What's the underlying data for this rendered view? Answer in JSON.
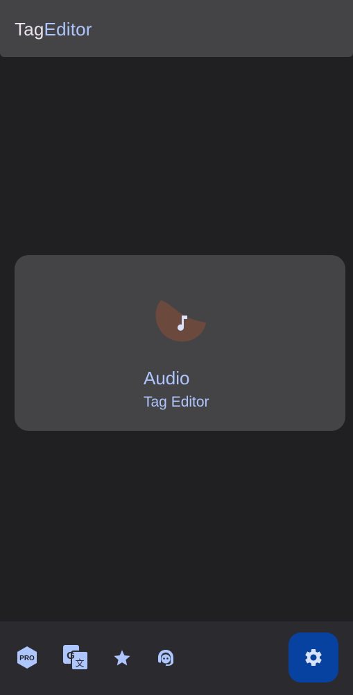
{
  "app_bar": {
    "title_part1": "Tag",
    "title_part2": "Editor"
  },
  "card": {
    "icon": "music-note-icon",
    "title": "Audio",
    "subtitle": "Tag Editor"
  },
  "bottom_bar": {
    "items": [
      {
        "icon": "pro-badge-icon",
        "label": "PRO"
      },
      {
        "icon": "translate-icon"
      },
      {
        "icon": "star-icon"
      },
      {
        "icon": "support-agent-icon"
      }
    ],
    "fab": {
      "icon": "settings-gear-icon"
    }
  },
  "colors": {
    "background": "#201f22",
    "surface": "#444345",
    "bottom_bar": "#2b2a2f",
    "accent": "#aec6ff",
    "fab": "#0842a0",
    "title_text": "#e7e3ea",
    "card_blob": "#6b4a3d"
  }
}
